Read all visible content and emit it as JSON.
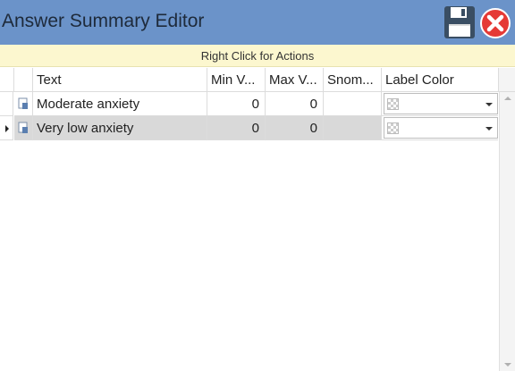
{
  "window": {
    "title": "Answer Summary Editor",
    "accent": "#6b93c9"
  },
  "toolbar": {
    "save_icon": "floppy-disk-icon",
    "close_icon": "red-x-circle-icon"
  },
  "hint": "Right Click for Actions",
  "grid": {
    "columns": [
      "Text",
      "Min V...",
      "Max V...",
      "Snom...",
      "Label Color"
    ],
    "rows": [
      {
        "text": "Moderate anxiety",
        "min": "0",
        "max": "0",
        "snomed": "",
        "color": ""
      },
      {
        "text": "Very low anxiety",
        "min": "0",
        "max": "0",
        "snomed": "",
        "color": ""
      }
    ],
    "selected_row": 1
  }
}
